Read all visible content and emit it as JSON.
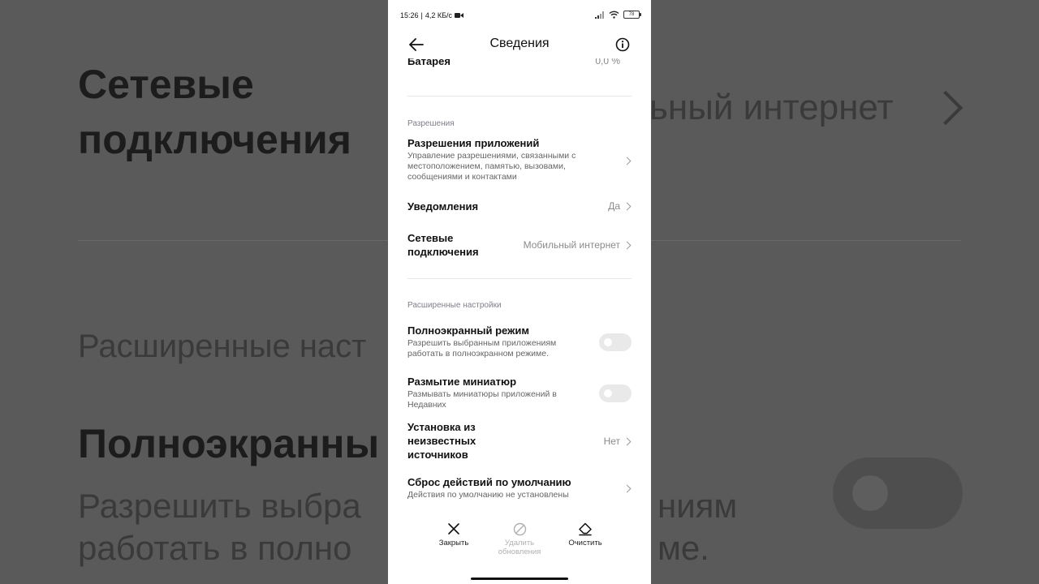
{
  "background": {
    "title_line1": "Сетевые",
    "title_line2": "подключения",
    "network_value": "ьный интернет",
    "advanced_section": "Расширенные наст",
    "fullscreen_title": "Полноэкранны",
    "fullscreen_desc_line1": "Разрешить выбра",
    "fullscreen_desc_line1_end": "ниям",
    "fullscreen_desc_line2": "работать в полно",
    "fullscreen_desc_line2_end": "ме."
  },
  "status_bar": {
    "time": "15:26",
    "separator": "|",
    "speed": "4,2 КБ/с",
    "battery": "78"
  },
  "header": {
    "title": "Сведения"
  },
  "partial_row": {
    "label": "Батарея",
    "value": "0,0 %"
  },
  "sections": {
    "permissions": "Разрешения",
    "advanced": "Расширенные настройки"
  },
  "rows": {
    "app_permissions": {
      "label": "Разрешения приложений",
      "sub": "Управление разрешениями, связанными с местоположением, памятью, вызовами, сообщениями и контактами"
    },
    "notifications": {
      "label": "Уведомления",
      "value": "Да"
    },
    "network": {
      "label": "Сетевые подключения",
      "value": "Мобильный интернет"
    },
    "fullscreen": {
      "label": "Полноэкранный режим",
      "sub": "Разрешить выбранным приложениям работать в полноэкранном режиме."
    },
    "blur": {
      "label": "Размытие миниатюр",
      "sub": "Размывать миниатюры приложений в Недавних"
    },
    "unknown_sources": {
      "label": "Установка из неизвестных источников",
      "value": "Нет"
    },
    "reset_defaults": {
      "label": "Сброс действий по умолчанию",
      "sub": "Действия по умолчанию не установлены"
    }
  },
  "bottom_actions": {
    "close": "Закрыть",
    "uninstall_updates": "Удалить обновления",
    "clear": "Очистить"
  }
}
